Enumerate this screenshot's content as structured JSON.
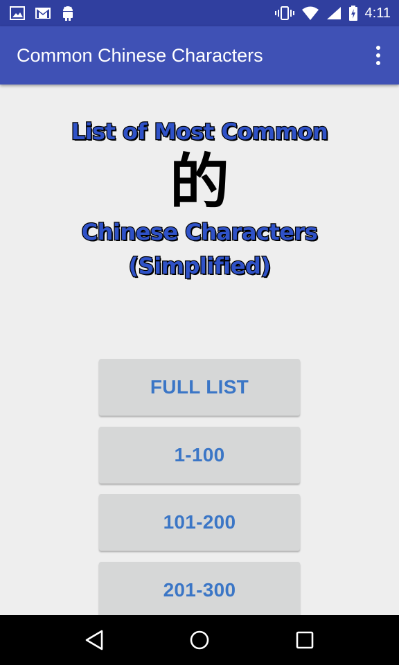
{
  "status_bar": {
    "time": "4:11",
    "left_icons": [
      "image-icon",
      "gmail-icon",
      "android-icon"
    ],
    "right_icons": [
      "vibrate-icon",
      "wifi-icon",
      "signal-icon",
      "battery-charging-icon"
    ]
  },
  "app_bar": {
    "title": "Common Chinese Characters",
    "menu_icon": "overflow-menu-icon"
  },
  "logo": {
    "line1": "List of Most Common",
    "character": "的",
    "line2": "Chinese Characters",
    "line3": "(Simplified)"
  },
  "buttons": [
    {
      "label": "FULL LIST"
    },
    {
      "label": "1-100"
    },
    {
      "label": "101-200"
    },
    {
      "label": "201-300"
    }
  ],
  "nav_bar": {
    "icons": [
      "back-icon",
      "home-icon",
      "recents-icon"
    ]
  },
  "colors": {
    "status_bar": "#303f9f",
    "app_bar": "#3f51b5",
    "button_text": "#3b76c6",
    "button_bg": "#d6d7d7",
    "background": "#eeeeee"
  }
}
